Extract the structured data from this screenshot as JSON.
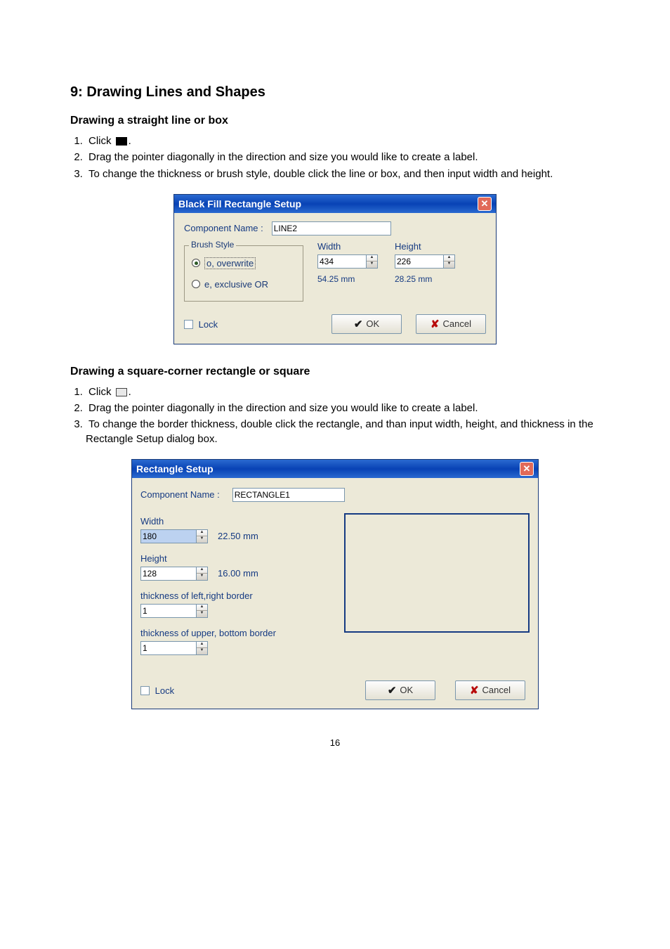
{
  "section_title": "9: Drawing Lines and Shapes",
  "sub1": {
    "title": "Drawing a straight line or box",
    "steps": [
      "Click",
      "Drag the pointer diagonally in the direction and size you would like to create a label.",
      "To change the thickness or brush style, double click the line or box, and then input width and height."
    ],
    "period": "."
  },
  "dialog1": {
    "title": "Black Fill Rectangle Setup",
    "component_label": "Component Name :",
    "component_value": "LINE2",
    "brush_style_legend": "Brush Style",
    "radio_overwrite": "o, overwrite",
    "radio_xor": "e, exclusive OR",
    "width_label": "Width",
    "width_value": "434",
    "width_mm": "54.25 mm",
    "height_label": "Height",
    "height_value": "226",
    "height_mm": "28.25 mm",
    "lock_label": "Lock",
    "ok_label": "OK",
    "cancel_label": "Cancel"
  },
  "sub2": {
    "title": "Drawing a square-corner rectangle or square",
    "steps": [
      "Click",
      "Drag the pointer diagonally in the direction and size you would like to create a label.",
      "To change the border thickness, double click the rectangle, and than input width, height, and thickness in the Rectangle Setup dialog box."
    ],
    "period": "."
  },
  "dialog2": {
    "title": "Rectangle Setup",
    "component_label": "Component Name :",
    "component_value": "RECTANGLE1",
    "width_label": "Width",
    "width_value": "180",
    "width_mm": "22.50 mm",
    "height_label": "Height",
    "height_value": "128",
    "height_mm": "16.00 mm",
    "thick_lr_label": "thickness of left,right border",
    "thick_lr_value": "1",
    "thick_ub_label": "thickness of upper, bottom border",
    "thick_ub_value": "1",
    "lock_label": "Lock",
    "ok_label": "OK",
    "cancel_label": "Cancel"
  },
  "page_number": "16"
}
